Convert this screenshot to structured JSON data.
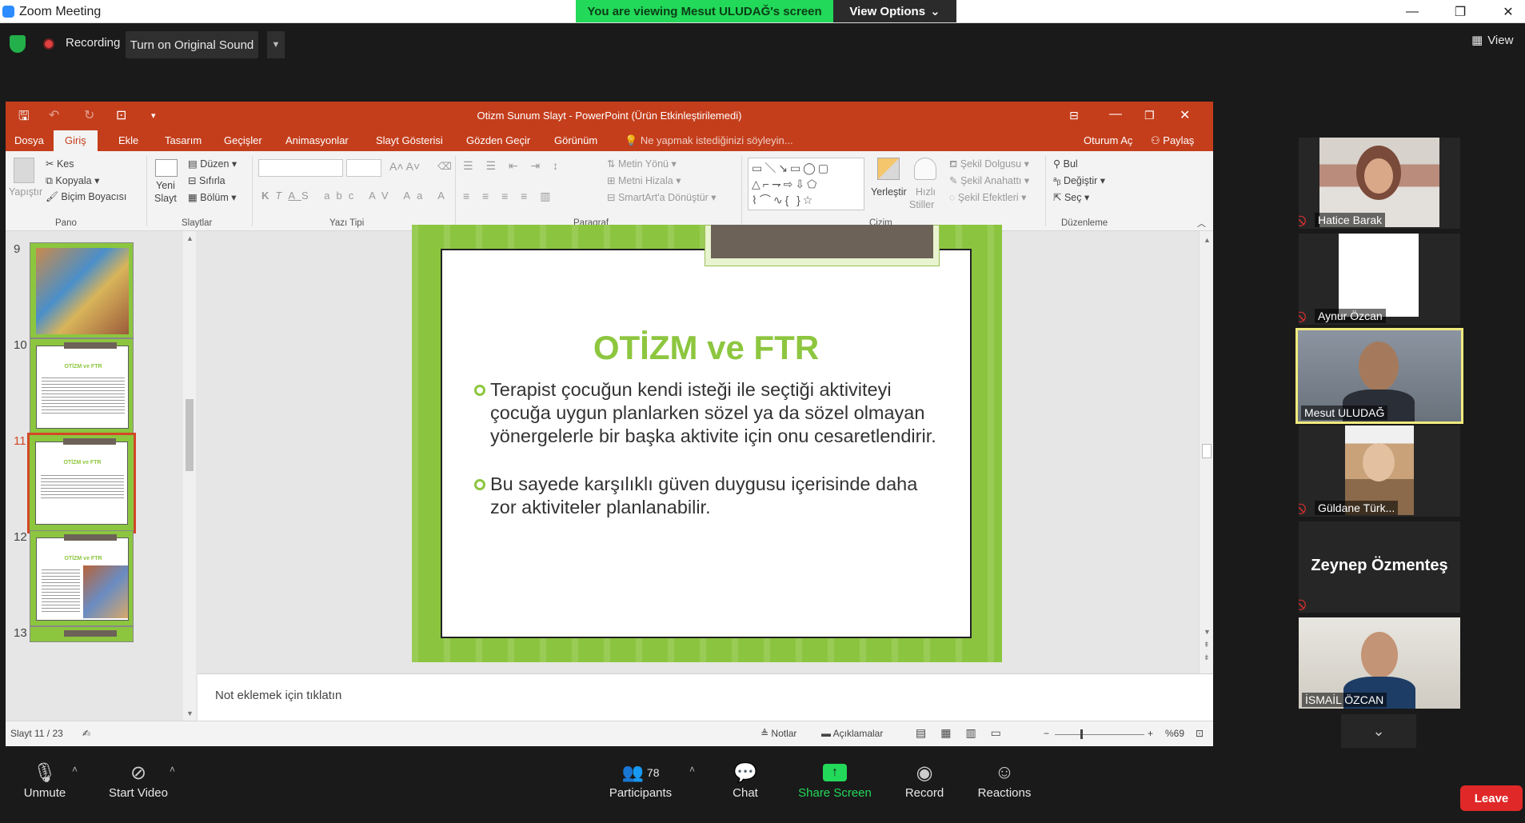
{
  "window": {
    "app_title": "Zoom Meeting",
    "viewing_banner": "You are viewing Mesut ULUDAĞ's screen",
    "view_options": "View Options",
    "minimize": "—",
    "maximize": "❐",
    "close": "✕"
  },
  "zoom_top": {
    "recording": "Recording",
    "original_sound": "Turn on Original Sound",
    "view": "View"
  },
  "ppt": {
    "window_title": "Otizm Sunum Slayt - PowerPoint (Ürün Etkinleştirilemedi)",
    "tabs": [
      "Dosya",
      "Giriş",
      "Ekle",
      "Tasarım",
      "Geçişler",
      "Animasyonlar",
      "Slayt Gösterisi",
      "Gözden Geçir",
      "Görünüm"
    ],
    "tell_me": "Ne yapmak istediğinizi söyleyin...",
    "sign_in": "Oturum Aç",
    "share": "Paylaş",
    "ribbon": {
      "paste": "Yapıştır",
      "cut": "Kes",
      "copy": "Kopyala",
      "format_painter": "Biçim Boyacısı",
      "new_slide_1": "Yeni",
      "new_slide_2": "Slayt",
      "layout": "Düzen",
      "reset": "Sıfırla",
      "section": "Bölüm",
      "text_direction": "Metin Yönü",
      "align_text": "Metni Hizala",
      "smartart": "SmartArt'a Dönüştür",
      "arrange": "Yerleştir",
      "quick_styles_1": "Hızlı",
      "quick_styles_2": "Stiller",
      "shape_fill": "Şekil Dolgusu",
      "shape_outline": "Şekil Anahattı",
      "shape_effects": "Şekil Efektleri",
      "find": "Bul",
      "replace": "Değiştir",
      "select": "Seç",
      "groups": [
        "Pano",
        "Slaytlar",
        "Yazı Tipi",
        "Paragraf",
        "Çizim",
        "Düzenleme"
      ]
    },
    "thumbnails": [
      {
        "num": "9"
      },
      {
        "num": "10",
        "title": "OTİZM ve FTR"
      },
      {
        "num": "11",
        "title": "OTİZM ve FTR"
      },
      {
        "num": "12",
        "title": "OTİZM ve FTR"
      },
      {
        "num": "13"
      }
    ],
    "slide": {
      "title": "OTİZM ve FTR",
      "bullets": [
        "Terapist çocuğun kendi isteği ile seçtiği aktiviteyi çocuğa uygun planlarken sözel ya da sözel olmayan yönergelerle bir başka aktivite için onu cesaretlendirir.",
        "Bu sayede karşılıklı güven duygusu içerisinde daha zor aktiviteler planlanabilir."
      ]
    },
    "notes_placeholder": "Not eklemek için tıklatın",
    "status": {
      "slide_counter": "Slayt 11 / 23",
      "notes": "Notlar",
      "comments": "Açıklamalar",
      "zoom": "%69"
    }
  },
  "participants": [
    {
      "name": "Hatice Barak"
    },
    {
      "name": "Aynur Özcan"
    },
    {
      "name": "Mesut ULUDAĞ"
    },
    {
      "name": "Güldane Türk..."
    },
    {
      "name": "Zeynep Özmenteş"
    },
    {
      "name": "İSMAİL ÖZCAN"
    }
  ],
  "toolbar": {
    "unmute": "Unmute",
    "start_video": "Start Video",
    "participants": "Participants",
    "participant_count": "78",
    "chat": "Chat",
    "share_screen": "Share Screen",
    "record": "Record",
    "reactions": "Reactions",
    "leave": "Leave"
  },
  "colors": {
    "ppt_accent": "#c43e1c",
    "slide_green": "#8dc63f",
    "share_green": "#23d959",
    "leave_red": "#e02828",
    "active_speaker": "#f0ea7d"
  }
}
